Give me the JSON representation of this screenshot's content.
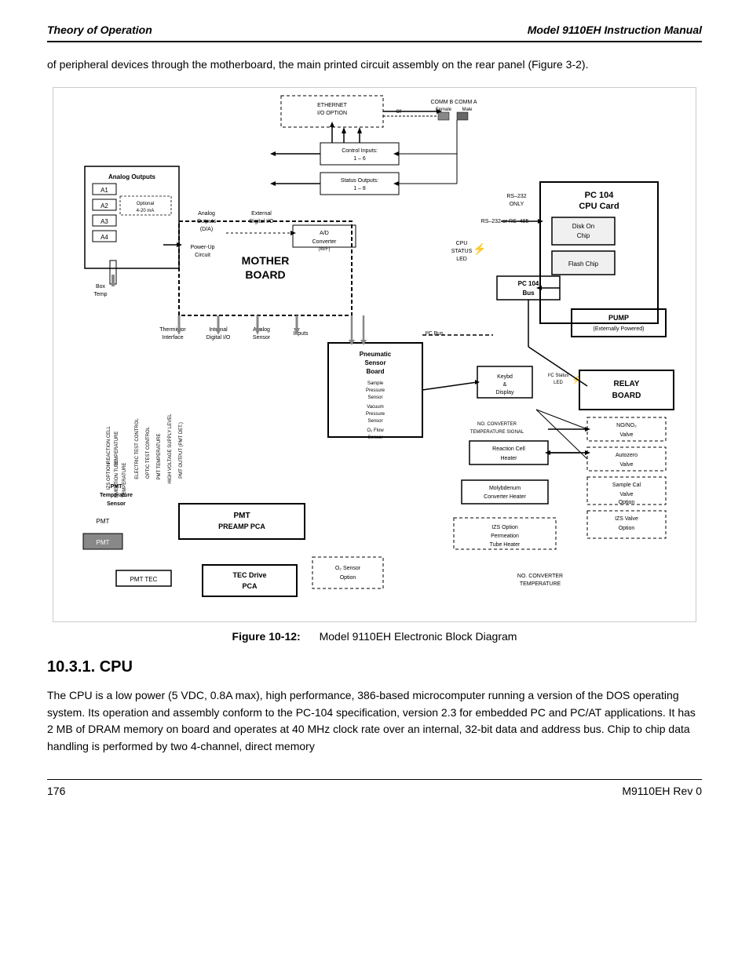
{
  "header": {
    "left": "Theory of Operation",
    "right": "Model 9110EH Instruction Manual"
  },
  "intro_text": "of peripheral devices through the motherboard, the main printed circuit assembly on the rear panel (Figure 3-2).",
  "figure_caption": {
    "label": "Figure 10-12:",
    "description": "Model 9110EH Electronic Block Diagram"
  },
  "section": {
    "number": "10.3.1. CPU",
    "body": "The CPU is a low power (5 VDC, 0.8A max), high performance, 386-based microcomputer running a version of the DOS operating system. Its operation and assembly conform to the PC-104 specification, version 2.3 for embedded PC and PC/AT applications. It has 2 MB of DRAM memory on board and operates at 40 MHz clock rate over an internal, 32-bit data and address bus. Chip to chip data handling is performed by two 4-channel, direct memory"
  },
  "footer": {
    "left": "176",
    "right": "M9110EH Rev 0"
  },
  "diagram": {
    "disk_chip_label": "Disk On\nChip"
  }
}
